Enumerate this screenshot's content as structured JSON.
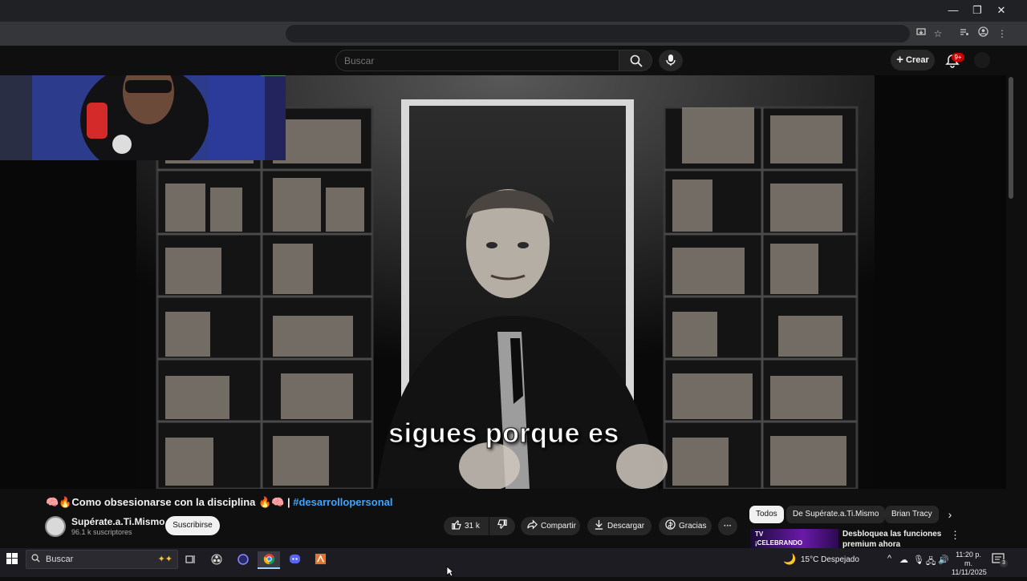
{
  "browser": {
    "window_controls": {
      "minimize": "—",
      "maximize": "❐",
      "close": "✕"
    }
  },
  "youtube": {
    "search": {
      "placeholder": "Buscar"
    },
    "create_label": "Crear",
    "notifications_badge": "9+"
  },
  "video": {
    "caption": "sigues porque es",
    "title_prefix": "🧠🔥Como obsesionarse con la disciplina 🔥🧠 | ",
    "title_hashtag": "#desarrollopersonal"
  },
  "channel": {
    "name": "Supérate.a.Ti.Mismo",
    "subscribers": "96.1 k suscriptores",
    "subscribe_label": "Suscribirse"
  },
  "actions": {
    "like_count": "31 k",
    "share": "Compartir",
    "download": "Descargar",
    "thanks": "Gracias"
  },
  "sidebar": {
    "chips": [
      "Todos",
      "De Supérate.a.Ti.Mismo",
      "Brian Tracy"
    ],
    "promo_line1": "Desbloquea las funciones",
    "promo_line2": "premium ahora",
    "promo_thumb_text": "¡CELEBRANDO"
  },
  "taskbar": {
    "search_placeholder": "Buscar",
    "weather": "15°C  Despejado",
    "time": "11:20 p. m.",
    "date": "11/11/2025",
    "notification_count": "3"
  },
  "colors": {
    "background": "#0f0f0f",
    "hashtag": "#3ea6ff",
    "badge": "#cc0000"
  }
}
